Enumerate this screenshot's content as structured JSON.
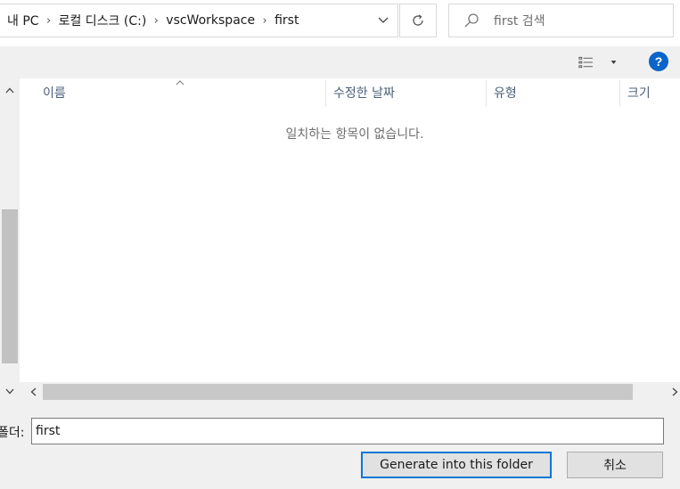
{
  "address_bar": {
    "crumbs": [
      "내 PC",
      "로컬 디스크 (C:)",
      "vscWorkspace",
      "first"
    ],
    "separator": "›"
  },
  "search": {
    "placeholder": "first 검색"
  },
  "toolbar": {
    "help_label": "?"
  },
  "columns": [
    "이름",
    "수정한 날짜",
    "유형",
    "크기"
  ],
  "empty_message": "일치하는 항목이 없습니다.",
  "footer": {
    "folder_label": "폴더:",
    "folder_value": "first",
    "primary_button": "Generate into this folder",
    "cancel_button": "취소"
  },
  "colors": {
    "accent": "#0078d7",
    "help_icon": "#0a64c9",
    "header_text": "#4c607a"
  }
}
